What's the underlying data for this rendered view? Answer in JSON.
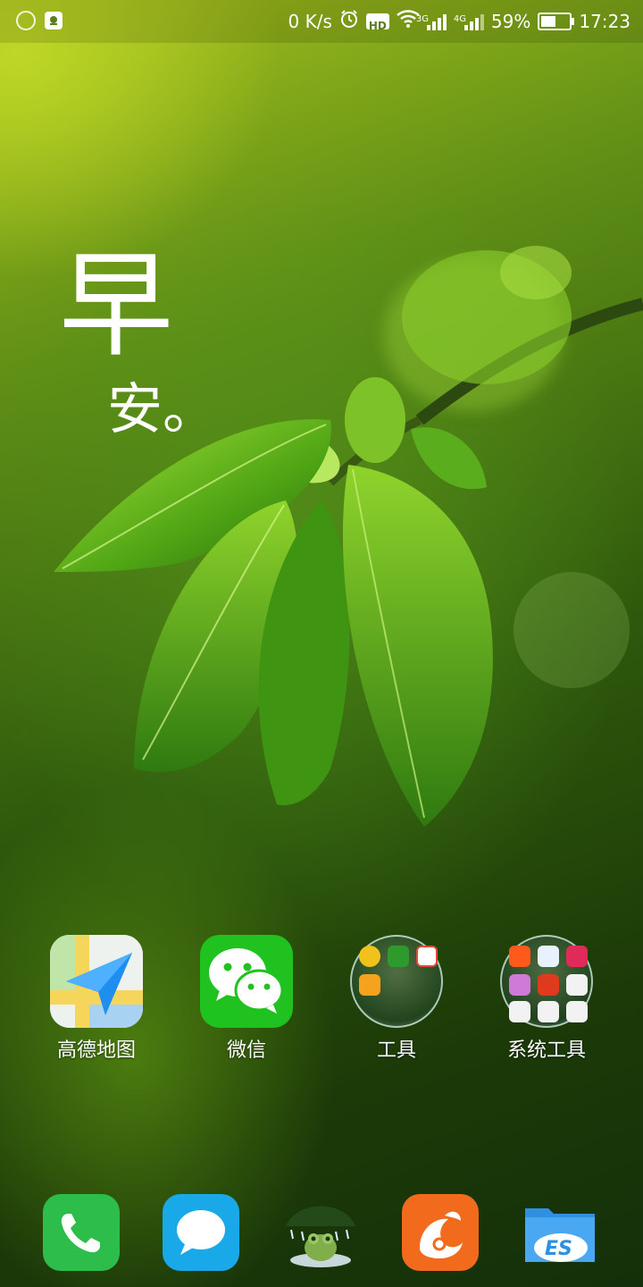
{
  "status_bar": {
    "net_speed": "0 K/s",
    "hd_label": "HD",
    "sim1_gen": "3G",
    "sim2_gen": "4G",
    "battery_percent": "59%",
    "battery_level": 0.59,
    "time": "17:23",
    "icons": [
      "sync-ring-icon",
      "notification-app-icon",
      "alarm-icon",
      "hd-icon",
      "wifi-icon",
      "signal-3g-icon",
      "signal-4g-icon",
      "battery-icon"
    ]
  },
  "greeting": {
    "line1": "早",
    "line2": "安。"
  },
  "apps": [
    {
      "label": "高德地图",
      "icon": "amap-icon"
    },
    {
      "label": "微信",
      "icon": "wechat-icon"
    },
    {
      "label": "工具",
      "icon": "tools-folder-icon"
    },
    {
      "label": "系统工具",
      "icon": "system-tools-folder-icon"
    }
  ],
  "dock": [
    {
      "icon": "phone-icon",
      "color": "#2dbd4a"
    },
    {
      "icon": "messages-icon",
      "color": "#19a8e8"
    },
    {
      "icon": "frog-weather-icon",
      "color": "#3a6a2a"
    },
    {
      "icon": "uc-browser-icon",
      "color": "#f26a1b"
    },
    {
      "icon": "es-file-explorer-icon",
      "color": "#2f8fe0"
    }
  ]
}
